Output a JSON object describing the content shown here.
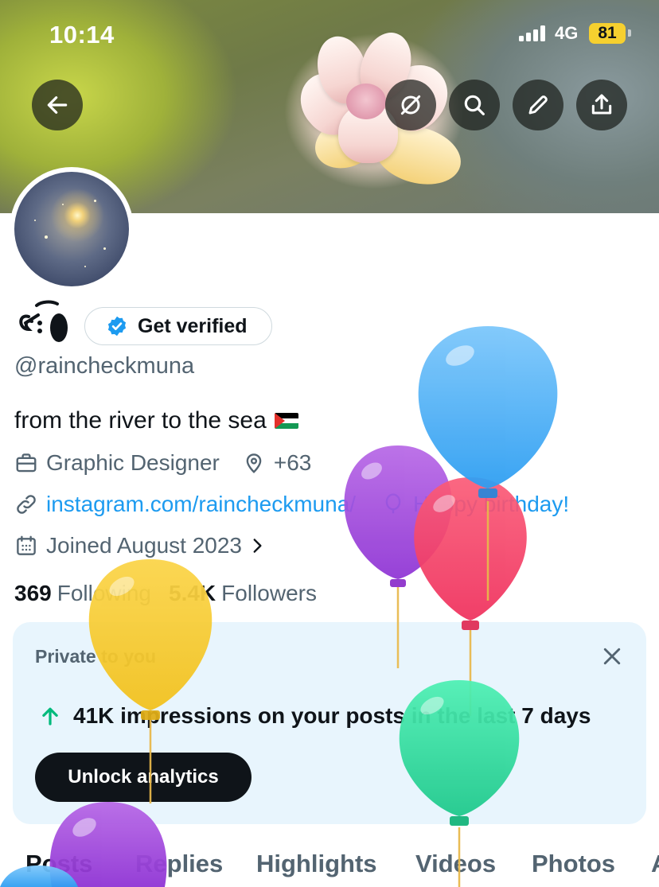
{
  "status_bar": {
    "time": "10:14",
    "network": "4G",
    "battery": "81"
  },
  "header": {
    "back_icon": "arrow-left-icon",
    "actions": [
      "no-circle-icon",
      "search-icon",
      "edit-icon",
      "share-icon"
    ]
  },
  "profile": {
    "display_name": "ꗃ⁠͜ 𝇋",
    "verified_label": "Get verified",
    "handle": "@raincheckmuna",
    "bio": "from the river to the sea",
    "job": "Graphic Designer",
    "location": "+63",
    "link": "instagram.com/raincheckmuna/",
    "birthday": "Happy birthday!",
    "joined": "Joined August 2023",
    "following_count": "369",
    "following_label": "Following",
    "followers_count": "5.4K",
    "followers_label": "Followers"
  },
  "analytics_card": {
    "title": "Private to you",
    "stat": "41K impressions on your posts in the last 7 days",
    "button": "Unlock analytics"
  },
  "tabs": [
    "Posts",
    "Replies",
    "Highlights",
    "Videos",
    "Photos",
    "A"
  ],
  "colors": {
    "accent": "#1d9bf0",
    "text_primary": "#0f1419",
    "text_secondary": "#536471",
    "card_bg": "#e8f5fd",
    "battery": "#f6d02f",
    "trend_up": "#00ba7c"
  }
}
